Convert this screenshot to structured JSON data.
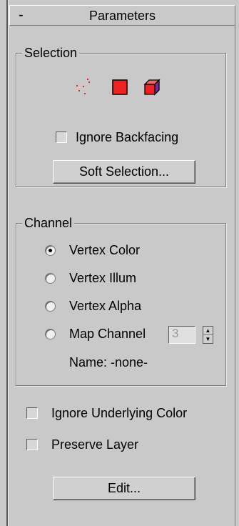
{
  "rollout": {
    "collapse_symbol": "-",
    "title": "Parameters"
  },
  "selection": {
    "group_label": "Selection",
    "modes": [
      {
        "name": "vertex-mode-icon",
        "icon": "vertex-dots"
      },
      {
        "name": "face-mode-icon",
        "icon": "red-square"
      },
      {
        "name": "element-mode-icon",
        "icon": "red-cube"
      }
    ],
    "ignore_backfacing_label": "Ignore Backfacing",
    "ignore_backfacing_checked": false,
    "soft_selection_button": "Soft Selection..."
  },
  "channel": {
    "group_label": "Channel",
    "options": [
      {
        "label": "Vertex Color",
        "selected": true
      },
      {
        "label": "Vertex Illum",
        "selected": false
      },
      {
        "label": "Vertex Alpha",
        "selected": false
      },
      {
        "label": "Map Channel",
        "selected": false
      }
    ],
    "map_channel_value": "3",
    "name_label": "Name: -none-"
  },
  "ignore_underlying_label": "Ignore Underlying Color",
  "ignore_underlying_checked": false,
  "preserve_layer_label": "Preserve Layer",
  "preserve_layer_checked": false,
  "edit_button": "Edit...",
  "colors": {
    "background": "#c9c9c9",
    "selection_red": "#ee2222",
    "element_purple": "#7a2a9a"
  }
}
